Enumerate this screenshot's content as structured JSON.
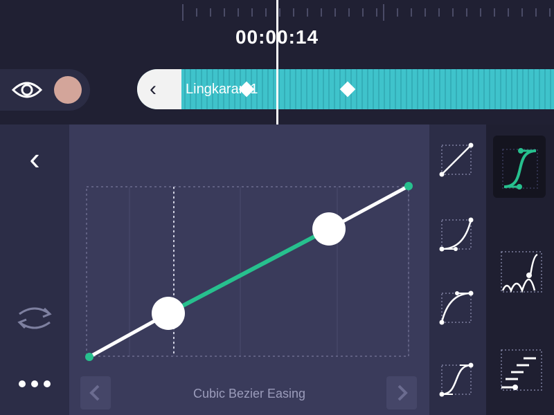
{
  "timeline": {
    "timecode": "00:00:14"
  },
  "layer": {
    "name": "Lingkaran 1",
    "swatch_color": "#d3a59a",
    "bar_color": "#3bbcc5"
  },
  "icons": {
    "visibility": "eye-icon",
    "collapse": "chevron-left-icon",
    "back": "chevron-left-icon",
    "loop": "swap-arrows-icon",
    "more": "ellipsis-icon",
    "prev": "chevron-left-icon",
    "next": "chevron-right-icon"
  },
  "toolbar": {
    "back_label": "‹",
    "collapse_label": "‹"
  },
  "easing_editor": {
    "preset_name": "Cubic Bezier Easing",
    "curve_color": "#27c08e",
    "line_color": "#ffffff"
  },
  "presets": [
    "linear",
    "ease-in",
    "ease-out",
    "ease-in-out"
  ],
  "categories": [
    "cubic-bezier",
    "bounce",
    "steps"
  ],
  "selected_category": "cubic-bezier"
}
